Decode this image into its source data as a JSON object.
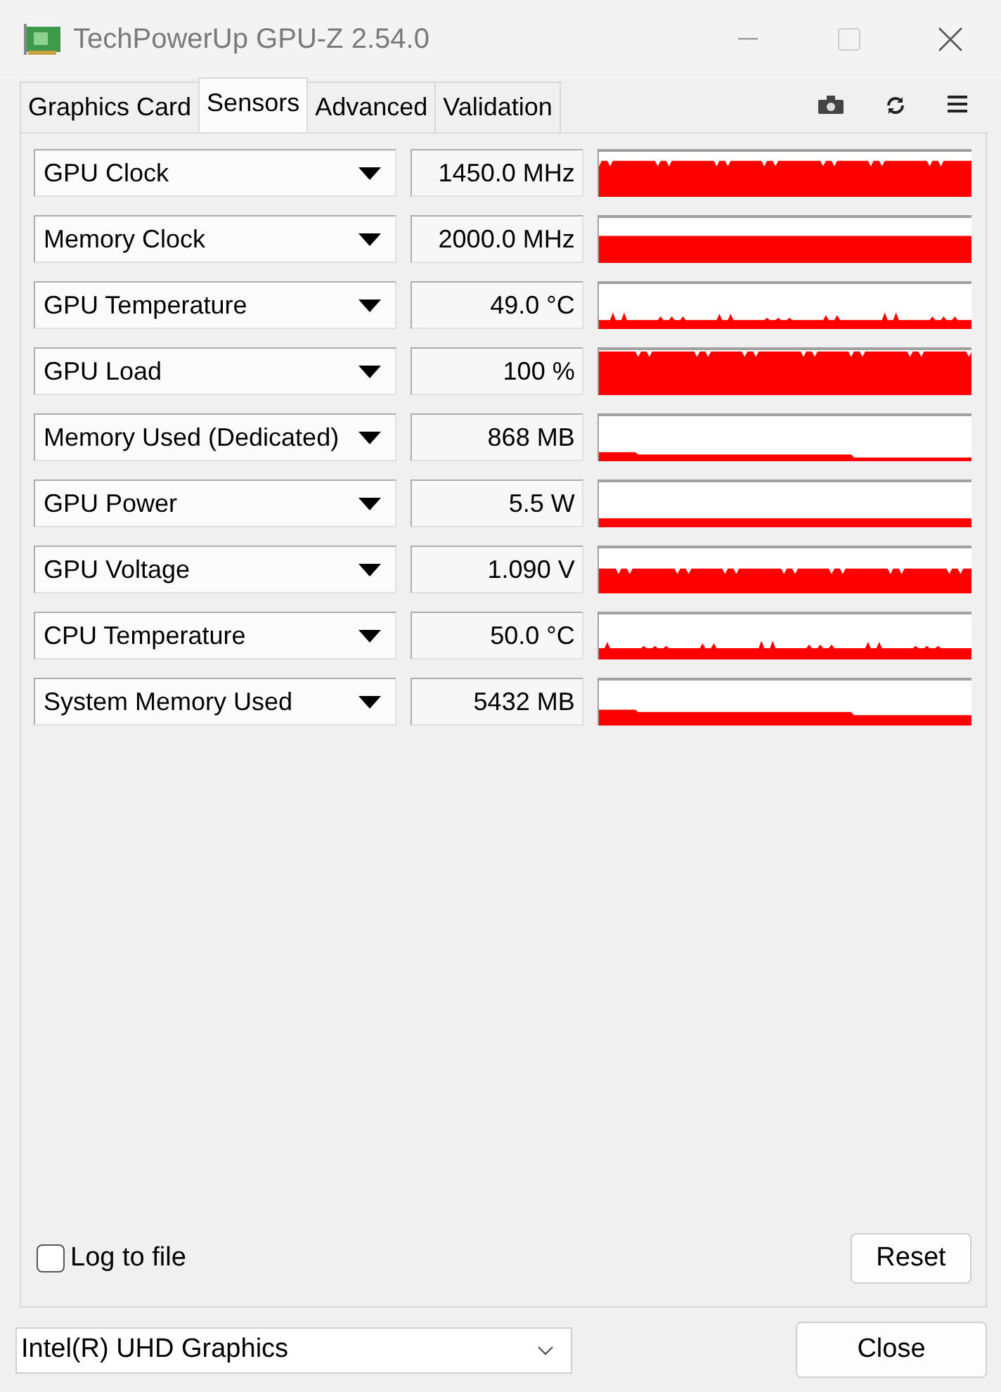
{
  "window": {
    "title": "TechPowerUp GPU-Z 2.54.0"
  },
  "tabs": [
    {
      "label": "Graphics Card",
      "selected": false
    },
    {
      "label": "Sensors",
      "selected": true
    },
    {
      "label": "Advanced",
      "selected": false
    },
    {
      "label": "Validation",
      "selected": false
    }
  ],
  "sensors": [
    {
      "name": "GPU Clock",
      "value": "1450.0 MHz"
    },
    {
      "name": "Memory Clock",
      "value": "2000.0 MHz"
    },
    {
      "name": "GPU Temperature",
      "value": "49.0 °C"
    },
    {
      "name": "GPU Load",
      "value": "100 %"
    },
    {
      "name": "Memory Used (Dedicated)",
      "value": "868 MB"
    },
    {
      "name": "GPU Power",
      "value": "5.5 W"
    },
    {
      "name": "GPU Voltage",
      "value": "1.090 V"
    },
    {
      "name": "CPU Temperature",
      "value": "50.0 °C"
    },
    {
      "name": "System Memory Used",
      "value": "5432 MB"
    }
  ],
  "log_to_file": {
    "label": "Log to file",
    "checked": false
  },
  "reset_button": "Reset",
  "device_select": {
    "value": "Intel(R) UHD Graphics"
  },
  "close_button": "Close"
}
